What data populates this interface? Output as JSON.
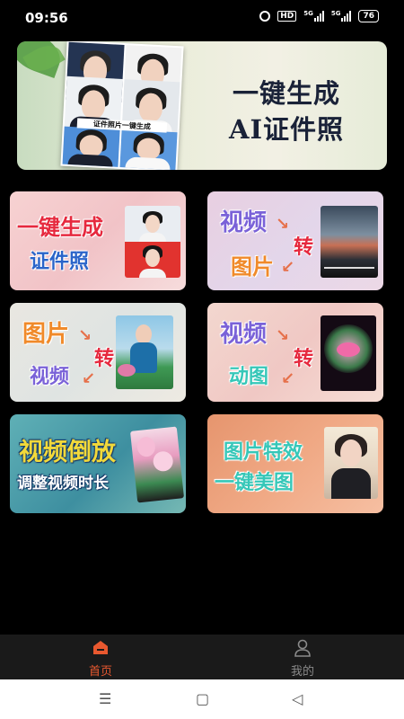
{
  "status_bar": {
    "time": "09:56",
    "hd_badge": "HD",
    "signal_1": "5G",
    "signal_2": "5G",
    "battery": "76"
  },
  "banner": {
    "title_line1": "一键生成",
    "title_line2": "AI证件照",
    "photo_caption": "证件照片一键生成"
  },
  "cards": [
    {
      "line1": "一键生成",
      "line2": "证件照"
    },
    {
      "line1": "视频",
      "arrow_word": "转",
      "line2": "图片"
    },
    {
      "line1": "图片",
      "arrow_word": "转",
      "line2": "视频"
    },
    {
      "line1": "视频",
      "arrow_word": "转",
      "line2": "动图"
    },
    {
      "line1": "视频倒放",
      "line2": "调整视频时长"
    },
    {
      "line1": "图片特效",
      "line2": "一键美图"
    }
  ],
  "bottom_nav": {
    "home_label": "首页",
    "mine_label": "我的",
    "active_color": "#e8582f",
    "inactive_color": "#8a8a8a"
  },
  "system_nav": {
    "menu_glyph": "☰",
    "home_glyph": "▢",
    "back_glyph": "◁"
  }
}
